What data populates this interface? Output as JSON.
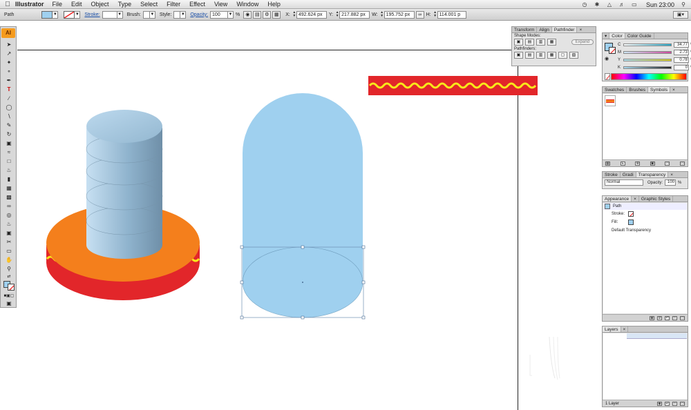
{
  "menubar": {
    "app_name": "Illustrator",
    "items": [
      "File",
      "Edit",
      "Object",
      "Type",
      "Select",
      "Filter",
      "Effect",
      "View",
      "Window",
      "Help"
    ],
    "clock": "Sun 23:00"
  },
  "controlbar": {
    "selection_label": "Path",
    "stroke_label": "Stroke:",
    "brush_label": "Brush:",
    "style_label": "Style:",
    "opacity_label": "Opacity:",
    "opacity_value": "100",
    "opacity_unit": "%",
    "x_label": "X:",
    "x_value": "492.624 px",
    "y_label": "Y:",
    "y_value": "217.882 px",
    "w_label": "W:",
    "w_value": "195.752 px",
    "h_label": "H:",
    "h_value": "114.001 p",
    "fill_color": "#9fd0ef"
  },
  "tools": {
    "badge": "AI"
  },
  "pathfinder_panel": {
    "tabs": [
      "Transform",
      "Align",
      "Pathfinder"
    ],
    "shape_modes_label": "Shape Modes:",
    "expand_label": "Expand",
    "pathfinders_label": "Pathfinders:"
  },
  "color_panel": {
    "tabs": [
      "Color",
      "Color Guide"
    ],
    "channels": [
      {
        "label": "C",
        "value": "34.77",
        "color": "#2aa8c8"
      },
      {
        "label": "M",
        "value": "2.73",
        "color": "#d04aa0"
      },
      {
        "label": "Y",
        "value": "0.78",
        "color": "#d8cc20"
      },
      {
        "label": "K",
        "value": "0",
        "color": "#444444"
      }
    ],
    "percent": "%"
  },
  "swatches_panel": {
    "tabs": [
      "Swatches",
      "Brushes",
      "Symbols"
    ]
  },
  "transparency_panel": {
    "tabs": [
      "Stroke",
      "Gradi",
      "Transparency"
    ],
    "blend_mode": "Normal",
    "opacity_label": "Opacity:",
    "opacity_value": "100",
    "percent": "%"
  },
  "appearance_panel": {
    "tabs": [
      "Appearance",
      "Graphic Styles"
    ],
    "object": "Path",
    "stroke_label": "Stroke:",
    "fill_label": "Fill:",
    "default_transparency": "Default Transparency"
  },
  "layers_panel": {
    "tabs": [
      "Layers"
    ],
    "layer_count": "1 Layer"
  },
  "artwork": {
    "orange": "#f47f1c",
    "red": "#e2262a",
    "yellow": "#f8e81a",
    "blue": "#9fd0ef",
    "steel": "#7ea4bf"
  }
}
